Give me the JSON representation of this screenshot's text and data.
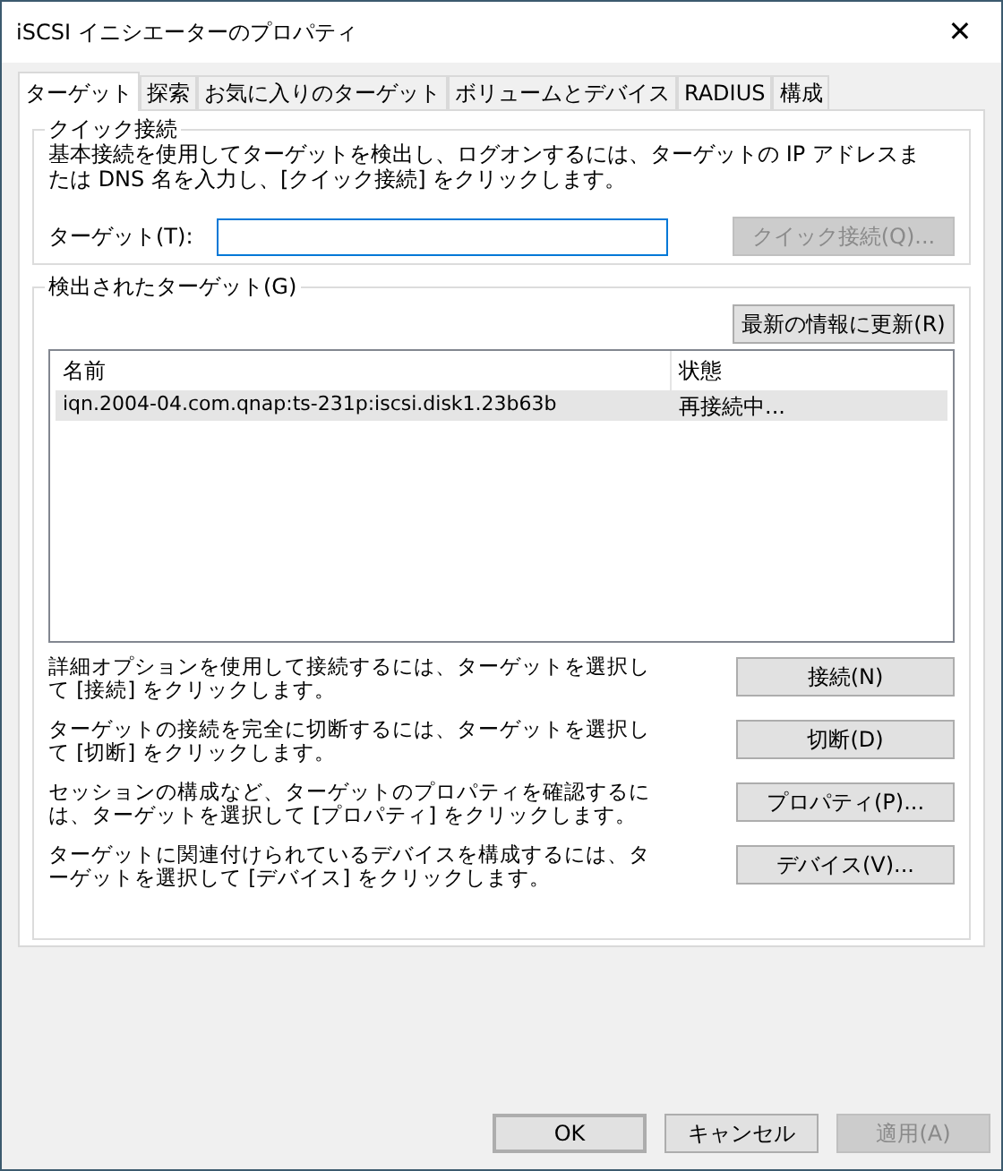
{
  "window": {
    "title": "iSCSI イニシエーターのプロパティ",
    "close": "✕"
  },
  "tabs": [
    {
      "label": "ターゲット",
      "selected": true
    },
    {
      "label": "探索",
      "selected": false
    },
    {
      "label": "お気に入りのターゲット",
      "selected": false
    },
    {
      "label": "ボリュームとデバイス",
      "selected": false
    },
    {
      "label": "RADIUS",
      "selected": false
    },
    {
      "label": "構成",
      "selected": false
    }
  ],
  "quick_connect": {
    "title": "クイック接続",
    "description": "基本接続を使用してターゲットを検出し、ログオンするには、ターゲットの IP アドレスまたは DNS 名を入力し、[クイック接続] をクリックします。",
    "target_label": "ターゲット(T):",
    "button": {
      "label": "クイック接続(Q)...",
      "disabled": true
    }
  },
  "discovered": {
    "title": "検出されたターゲット(G)",
    "refresh": "最新の情報に更新(R)",
    "columns": [
      "名前",
      "状態"
    ],
    "rows": [
      {
        "name": "iqn.2004-04.com.qnap:ts-231p:iscsi.disk1.23b63b",
        "status": "再接続中...",
        "selected": true
      }
    ]
  },
  "actions": [
    {
      "text": "詳細オプションを使用して接続するには、ターゲットを選択して [接続] をクリックします。",
      "button": "接続(N)"
    },
    {
      "text": "ターゲットの接続を完全に切断するには、ターゲットを選択して [切断] をクリックします。",
      "button": "切断(D)"
    },
    {
      "text": "セッションの構成など、ターゲットのプロパティを確認するには、ターゲットを選択して [プロパティ] をクリックします。",
      "button": "プロパティ(P)..."
    },
    {
      "text": "ターゲットに関連付けられているデバイスを構成するには、ターゲットを選択して [デバイス] をクリックします。",
      "button": "デバイス(V)..."
    }
  ],
  "buttons": [
    {
      "label": "OK",
      "kind": "default",
      "disabled": false
    },
    {
      "label": "キャンセル",
      "kind": "normal",
      "disabled": false
    },
    {
      "label": "適用(A)",
      "kind": "normal",
      "disabled": true
    }
  ]
}
